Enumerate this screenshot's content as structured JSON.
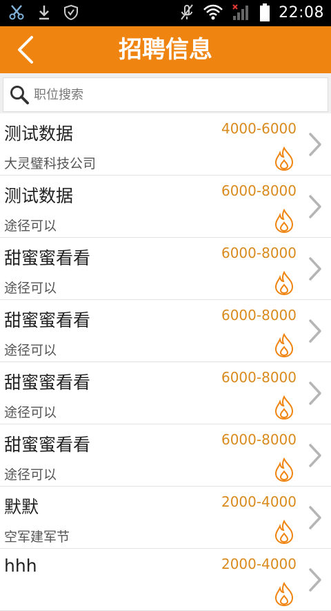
{
  "status_bar": {
    "time": "22:08",
    "icons": [
      "scissors-icon",
      "download-icon",
      "shield-icon",
      "mute-icon",
      "wifi-icon",
      "signal-icon",
      "battery-icon"
    ]
  },
  "header": {
    "title": "招聘信息",
    "back_icon": "back-arrow-icon"
  },
  "search": {
    "placeholder": "职位搜索"
  },
  "colors": {
    "brand_orange": "#f08411",
    "salary_text": "#d98a1c",
    "hot_icon": "#f08411"
  },
  "jobs": [
    {
      "title": "测试数据",
      "company": "大灵璧科技公司",
      "salary": "4000-6000"
    },
    {
      "title": "测试数据",
      "company": "途径可以",
      "salary": "6000-8000"
    },
    {
      "title": "甜蜜蜜看看",
      "company": "途径可以",
      "salary": "6000-8000"
    },
    {
      "title": "甜蜜蜜看看",
      "company": "途径可以",
      "salary": "6000-8000"
    },
    {
      "title": "甜蜜蜜看看",
      "company": "途径可以",
      "salary": "6000-8000"
    },
    {
      "title": "甜蜜蜜看看",
      "company": "途径可以",
      "salary": "6000-8000"
    },
    {
      "title": "默默",
      "company": "空军建军节",
      "salary": "2000-4000"
    },
    {
      "title": "hhh",
      "company": "",
      "salary": "2000-4000"
    }
  ]
}
